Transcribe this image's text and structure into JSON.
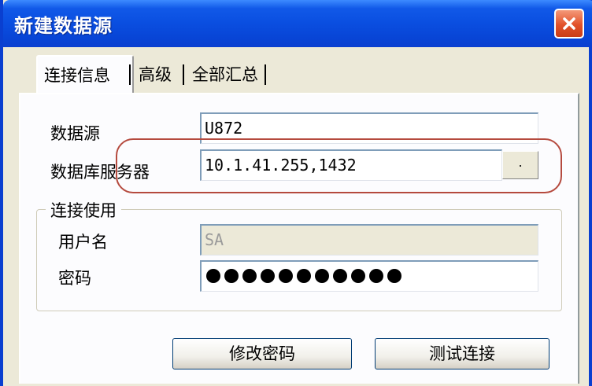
{
  "window": {
    "title": "新建数据源"
  },
  "tabs": [
    {
      "label": "连接信息"
    },
    {
      "label": "高级"
    },
    {
      "label": "全部汇总"
    }
  ],
  "form": {
    "datasource_label": "数据源",
    "datasource_value": "U872",
    "server_label": "数据库服务器",
    "server_value": "10.1.41.255,1432",
    "browse_label": ".",
    "group_title": "连接使用",
    "username_label": "用户名",
    "username_value": "SA",
    "password_label": "密码",
    "password_length": 11
  },
  "buttons": {
    "change_password": "修改密码",
    "test_connection": "测试连接"
  },
  "colors": {
    "titlebar": "#0a4ee0",
    "close_button": "#e2512a",
    "highlight_circle": "#b54a3e"
  },
  "icons": {
    "close": "close-icon"
  }
}
